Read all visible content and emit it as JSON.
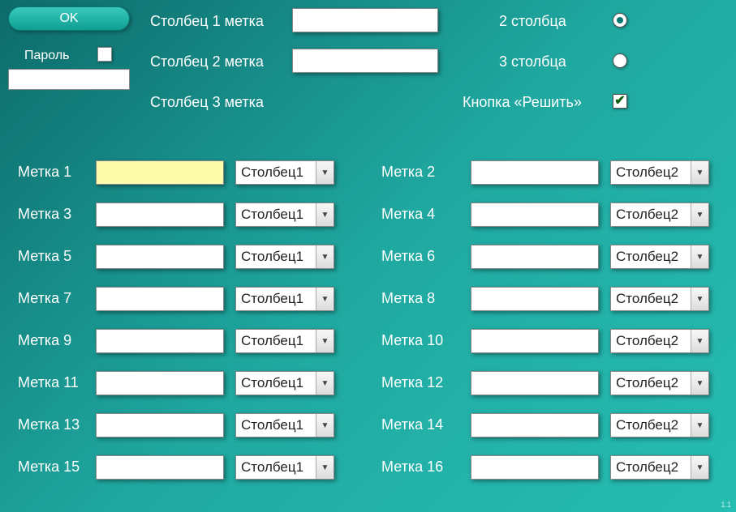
{
  "ok_button": "OK",
  "password_label": "Пароль",
  "col_labels": {
    "c1": "Столбец 1 метка",
    "c2": "Столбец 2 метка",
    "c3": "Столбец 3 метка"
  },
  "options": {
    "two_cols": "2 столбца",
    "three_cols": "3 столбца",
    "solve_btn": "Кнопка «Решить»",
    "solve_checked": "✔",
    "columns_selected": "2"
  },
  "rows": [
    {
      "label": "Метка 1",
      "select": "Столбец1",
      "highlight": true
    },
    {
      "label": "Метка 2",
      "select": "Столбец2"
    },
    {
      "label": "Метка 3",
      "select": "Столбец1"
    },
    {
      "label": "Метка 4",
      "select": "Столбец2"
    },
    {
      "label": "Метка 5",
      "select": "Столбец1"
    },
    {
      "label": "Метка 6",
      "select": "Столбец2"
    },
    {
      "label": "Метка 7",
      "select": "Столбец1"
    },
    {
      "label": "Метка 8",
      "select": "Столбец2"
    },
    {
      "label": "Метка 9",
      "select": "Столбец1"
    },
    {
      "label": "Метка 10",
      "select": "Столбец2"
    },
    {
      "label": "Метка 11",
      "select": "Столбец1"
    },
    {
      "label": "Метка 12",
      "select": "Столбец2"
    },
    {
      "label": "Метка 13",
      "select": "Столбец1"
    },
    {
      "label": "Метка 14",
      "select": "Столбец2"
    },
    {
      "label": "Метка 15",
      "select": "Столбец1"
    },
    {
      "label": "Метка 16",
      "select": "Столбец2"
    }
  ],
  "version": "1.1"
}
